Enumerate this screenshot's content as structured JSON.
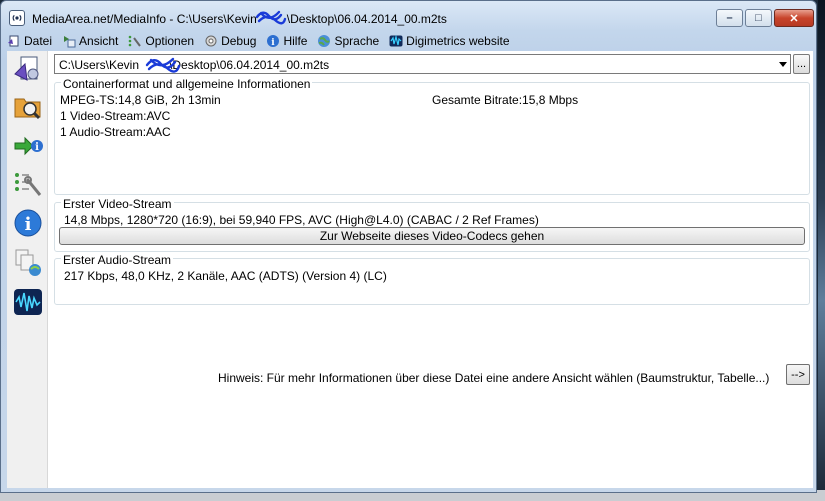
{
  "window": {
    "title": "MediaArea.net/MediaInfo - C:\\Users\\Kevin",
    "title_rest": "\\Desktop\\06.04.2014_00.m2ts",
    "buttons": {
      "minimize": "–",
      "maximize": "□",
      "close": "✕"
    }
  },
  "menu": [
    {
      "label": "Datei",
      "icon": "file-icon"
    },
    {
      "label": "Ansicht",
      "icon": "view-icon"
    },
    {
      "label": "Optionen",
      "icon": "options-icon"
    },
    {
      "label": "Debug",
      "icon": "debug-icon"
    },
    {
      "label": "Hilfe",
      "icon": "help-icon"
    },
    {
      "label": "Sprache",
      "icon": "language-icon"
    },
    {
      "label": "Digimetrics website",
      "icon": "digimetrics-icon"
    }
  ],
  "toolbar_icons": [
    "open-file-icon",
    "open-folder-icon",
    "export-icon",
    "preferences-icon",
    "about-icon",
    "knowledge-base-icon",
    "digimetrics-wave-icon"
  ],
  "file_selector": {
    "value_prefix": "C:\\Users\\Kevin",
    "value_suffix": "\\Desktop\\06.04.2014_00.m2ts",
    "dots_label": "..."
  },
  "general": {
    "legend": "Containerformat und allgemeine Informationen",
    "line1": "MPEG-TS:14,8 GiB, 2h 13min",
    "bitrate": "Gesamte Bitrate:15,8 Mbps",
    "line2": "1 Video-Stream:AVC",
    "line3": "1 Audio-Stream:AAC"
  },
  "video": {
    "legend": "Erster Video-Stream",
    "details": "14,8 Mbps, 1280*720 (16:9), bei 59,940 FPS, AVC (High@L4.0) (CABAC / 2 Ref Frames)",
    "button": "Zur Webseite dieses Video-Codecs gehen"
  },
  "audio": {
    "legend": "Erster Audio-Stream",
    "details": "217 Kbps, 48,0 KHz, 2 Kanäle, AAC (ADTS) (Version 4) (LC)"
  },
  "hint": {
    "text": "Hinweis: Für mehr Informationen über diese Datei eine andere Ansicht wählen (Baumstruktur, Tabelle...)",
    "button": "-->"
  },
  "colors": {
    "scribble": "#1a3bd8",
    "close_button": "#c8442c"
  }
}
